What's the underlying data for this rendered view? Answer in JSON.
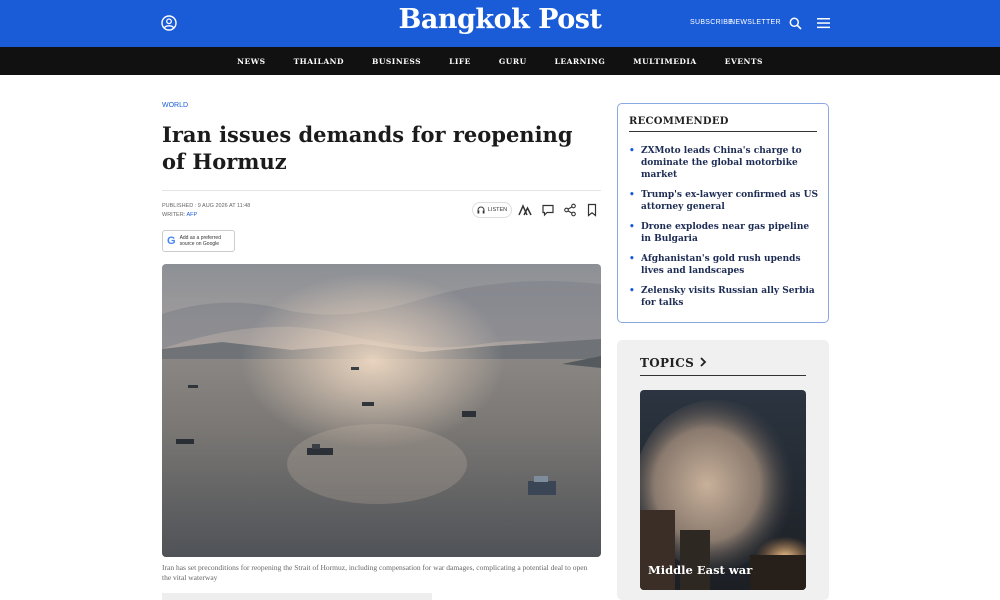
{
  "header": {
    "logo": "Bangkok Post",
    "subscribe_label": "SUBSCRIBE",
    "newsletter_label": "NEWSLETTER",
    "icons": {
      "user": "user-icon",
      "search": "search-icon",
      "menu": "menu-icon"
    },
    "brand_color": "#1a5cd8"
  },
  "nav": {
    "items": [
      "NEWS",
      "THAILAND",
      "BUSINESS",
      "LIFE",
      "GURU",
      "LEARNING",
      "MULTIMEDIA",
      "EVENTS"
    ]
  },
  "article": {
    "section": "WORLD",
    "headline": "Iran issues demands for reopening of Hormuz",
    "published_label": "PUBLISHED : 9 AUG 2026 AT 11:48",
    "writer_label": "WRITER:",
    "writer": "AFP",
    "listen_label": "LISTEN",
    "google_badge_line1": "Add as a preferred",
    "google_badge_line2": "source on Google",
    "caption": "Iran has set preconditions for reopening the Strait of Hormuz, including compensation for war damages, complicating a potential deal to open the vital waterway"
  },
  "recommended": {
    "title": "RECOMMENDED",
    "items": [
      "ZXMoto leads China's charge to dominate the global motorbike market",
      "Trump's ex-lawyer confirmed as US attorney general",
      "Drone explodes near gas pipeline in Bulgaria",
      "Afghanistan's gold rush upends lives and landscapes",
      "Zelensky visits Russian ally Serbia for talks"
    ]
  },
  "topics": {
    "title": "TOPICS",
    "chevron": "chevron-right-icon",
    "card_label": "Middle East war"
  }
}
